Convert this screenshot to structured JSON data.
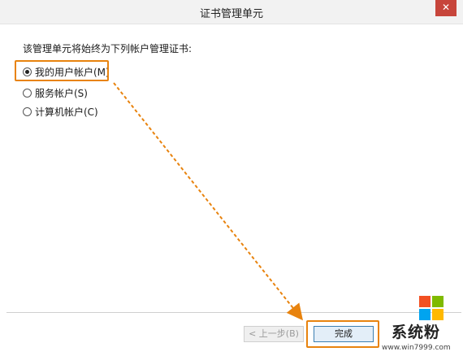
{
  "window": {
    "title": "证书管理单元",
    "close_icon": "✕"
  },
  "main": {
    "prompt": "该管理单元将始终为下列帐户管理证书:",
    "options": [
      {
        "label": "我的用户帐户(M)",
        "checked": true
      },
      {
        "label": "服务帐户(S)",
        "checked": false
      },
      {
        "label": "计算机帐户(C)",
        "checked": false
      }
    ]
  },
  "footer": {
    "back_label": "< 上一步(B)",
    "finish_label": "完成"
  },
  "annotations": {
    "highlight_color": "#e8830e",
    "arrow_color": "#e8830e"
  },
  "watermark": {
    "brand": "系统粉",
    "url": "www.win7999.com",
    "logo_colors": [
      "#f25022",
      "#7fba00",
      "#00a4ef",
      "#ffb900"
    ]
  }
}
